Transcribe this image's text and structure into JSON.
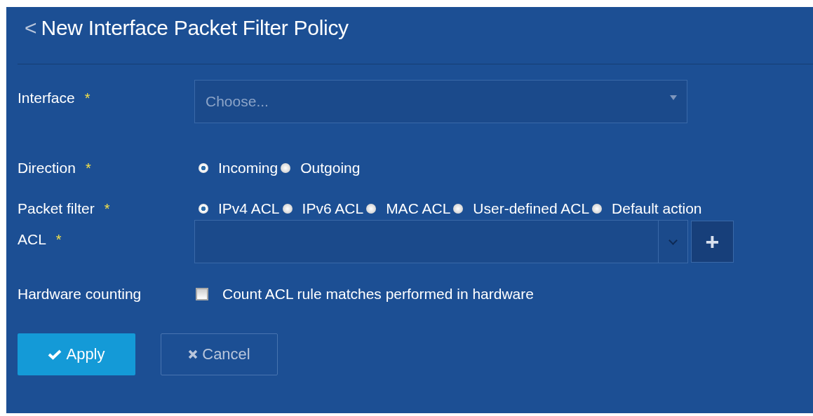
{
  "header": {
    "back_icon": "<",
    "title": "New Interface Packet Filter Policy"
  },
  "fields": [
    {
      "kind": "select",
      "label": "Interface",
      "required_mark": "*",
      "placeholder": "Choose..."
    },
    {
      "kind": "radio",
      "label": "Direction",
      "required_mark": "*",
      "options": [
        {
          "label": "Incoming",
          "selected": true
        },
        {
          "label": "Outgoing",
          "selected": false
        }
      ]
    },
    {
      "kind": "radio",
      "label": "Packet filter",
      "required_mark": "*",
      "options": [
        {
          "label": "IPv4 ACL",
          "selected": true
        },
        {
          "label": "IPv6 ACL",
          "selected": false
        },
        {
          "label": "MAC ACL",
          "selected": false
        },
        {
          "label": "User-defined ACL",
          "selected": false
        },
        {
          "label": "Default action",
          "selected": false
        }
      ]
    },
    {
      "kind": "combo",
      "label": "ACL",
      "required_mark": "*",
      "add_button": "+"
    },
    {
      "kind": "checkbox",
      "label": "Hardware counting",
      "checkbox_label": "Count ACL rule matches performed in hardware",
      "checked": false
    }
  ],
  "buttons": [
    {
      "kind": "primary",
      "label": "Apply"
    },
    {
      "kind": "secondary",
      "label": "Cancel"
    }
  ]
}
